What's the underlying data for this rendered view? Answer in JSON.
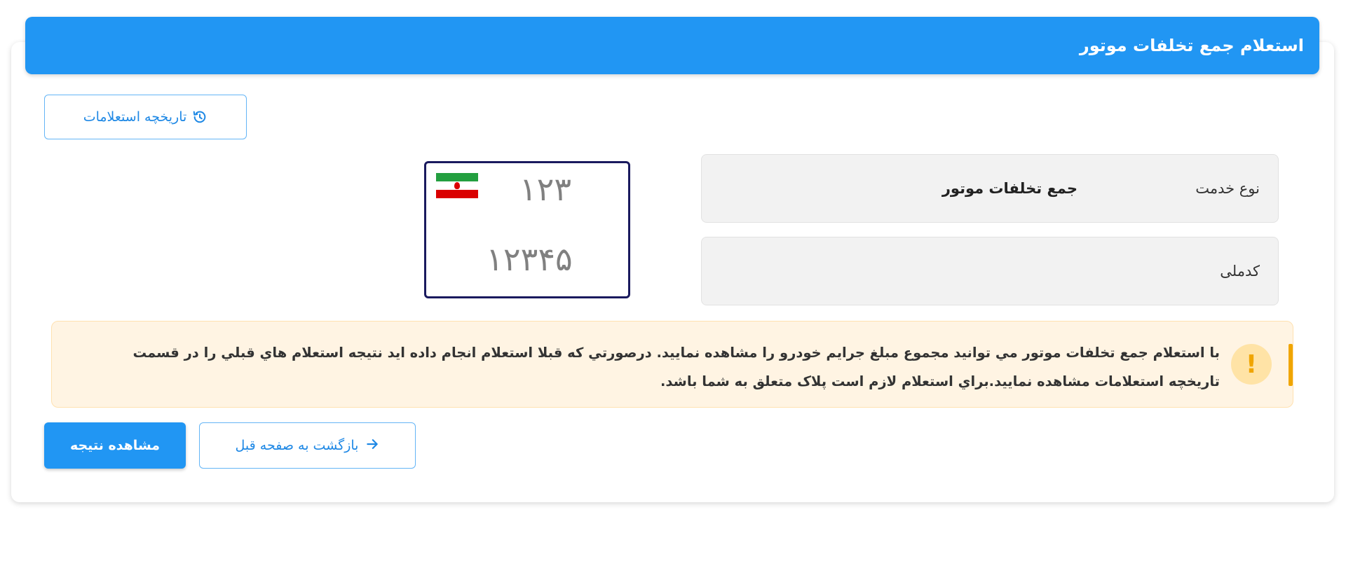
{
  "header": {
    "title": "استعلام جمع تخلفات موتور"
  },
  "history_button": {
    "label": "تاريخچه استعلامات",
    "icon": "history-icon"
  },
  "form": {
    "service_type": {
      "label": "نوع خدمت",
      "value": "جمع تخلفات موتور"
    },
    "national_code": {
      "label": "کدملی",
      "value": ""
    }
  },
  "plate": {
    "top": "۱۲۳",
    "bottom": "۱۲۳۴۵",
    "flag_icon": "iran-flag-icon"
  },
  "alert": {
    "icon": "warning-icon",
    "symbol": "!",
    "text": "با استعلام جمع تخلفات موتور مي توانيد مجموع مبلغ جرايم خودرو را مشاهده نماييد. درصورتي که قبلا استعلام انجام داده ايد نتيجه استعلام هاي قبلي را در قسمت تاريخچه استعلامات مشاهده نماييد.براي استعلام لازم است پلاک متعلق به شما باشد."
  },
  "actions": {
    "back_label": "بازگشت به صفحه قبل",
    "back_icon": "arrow-right-icon",
    "result_label": "مشاهده نتيجه"
  },
  "colors": {
    "primary": "#2196f3",
    "alert_bg": "#fff4e3",
    "alert_accent": "#f0a500",
    "plate_border": "#1a1a5e"
  }
}
